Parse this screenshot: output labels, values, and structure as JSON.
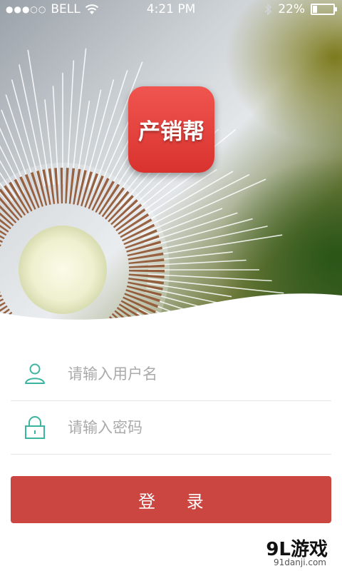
{
  "status_bar": {
    "signal": "●●●○○",
    "carrier": "BELL",
    "time": "4:21 PM",
    "battery_percent": "22%",
    "battery_level": 0.22
  },
  "app": {
    "name": "产销帮"
  },
  "login_form": {
    "username_placeholder": "请输入用户名",
    "password_placeholder": "请输入密码",
    "submit_label": "登 录"
  },
  "watermark": {
    "logo_text": "9L游戏",
    "site": "91danji.com"
  },
  "icons": [
    "wifi-icon",
    "bluetooth-icon",
    "battery-icon",
    "user-icon",
    "lock-icon"
  ],
  "colors": {
    "button": "#cb4640",
    "app_icon": "#e4413c",
    "field_icon": "#3cb5a0"
  }
}
